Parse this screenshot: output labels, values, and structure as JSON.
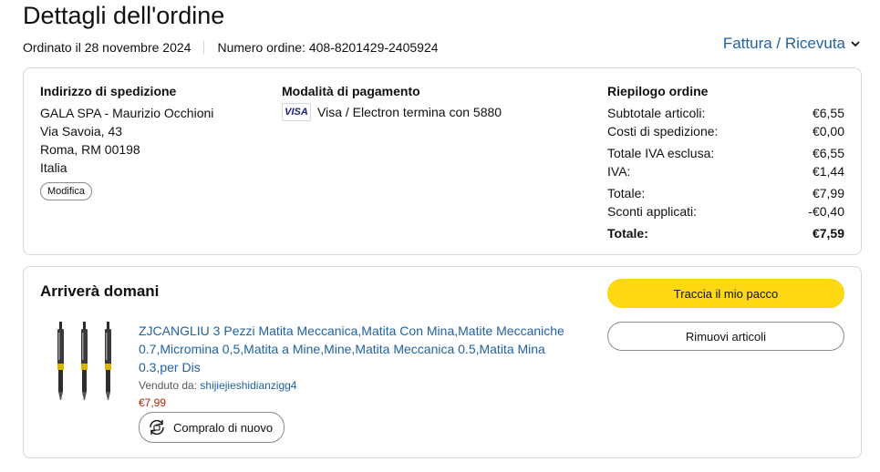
{
  "page": {
    "title": "Dettagli dell'ordine",
    "ordered_on": "Ordinato il 28 novembre 2024",
    "order_number": "Numero ordine: 408-8201429-2405924",
    "invoice_link": "Fattura / Ricevuta"
  },
  "shipping": {
    "title": "Indirizzo di spedizione",
    "name": "GALA SPA - Maurizio Occhioni",
    "street": "Via Savoia, 43",
    "city": "Roma, RM 00198",
    "country": "Italia",
    "edit_label": "Modifica"
  },
  "payment": {
    "title": "Modalità di pagamento",
    "card_logo": "VISA",
    "card_text": "Visa / Electron termina con 5880"
  },
  "summary": {
    "title": "Riepilogo ordine",
    "rows": [
      {
        "label": "Subtotale articoli:",
        "value": "€6,55"
      },
      {
        "label": "Costi di spedizione:",
        "value": "€0,00"
      },
      {
        "label": "Totale IVA esclusa:",
        "value": "€6,55"
      },
      {
        "label": "IVA:",
        "value": "€1,44"
      },
      {
        "label": "Totale:",
        "value": "€7,99"
      },
      {
        "label": "Sconti applicati:",
        "value": "-€0,40"
      },
      {
        "label": "Totale:",
        "value": "€7,59"
      }
    ]
  },
  "delivery": {
    "title": "Arriverà domani",
    "track_label": "Traccia il mio pacco",
    "remove_label": "Rimuovi articoli"
  },
  "product": {
    "title": "ZJCANGLIU 3 Pezzi Matita Meccanica,Matita Con Mina,Matite Meccaniche 0.7,Micromina 0,5,Matita a Mine,Mine,Matita Meccanica 0.5,Matita Mina 0.3,per Dis",
    "sold_by_prefix": "Venduto da:",
    "seller": "shijiejieshidianzigg4",
    "price": "€7,99",
    "buy_again_label": "Compralo di nuovo"
  },
  "icons": {
    "invoice_chevron": "chevron-down-icon",
    "buy_again": "buy-again-icon",
    "card": "visa-card-icon"
  },
  "colors": {
    "link": "#2162a1",
    "price": "#b12704",
    "primary_button": "#ffd814"
  }
}
